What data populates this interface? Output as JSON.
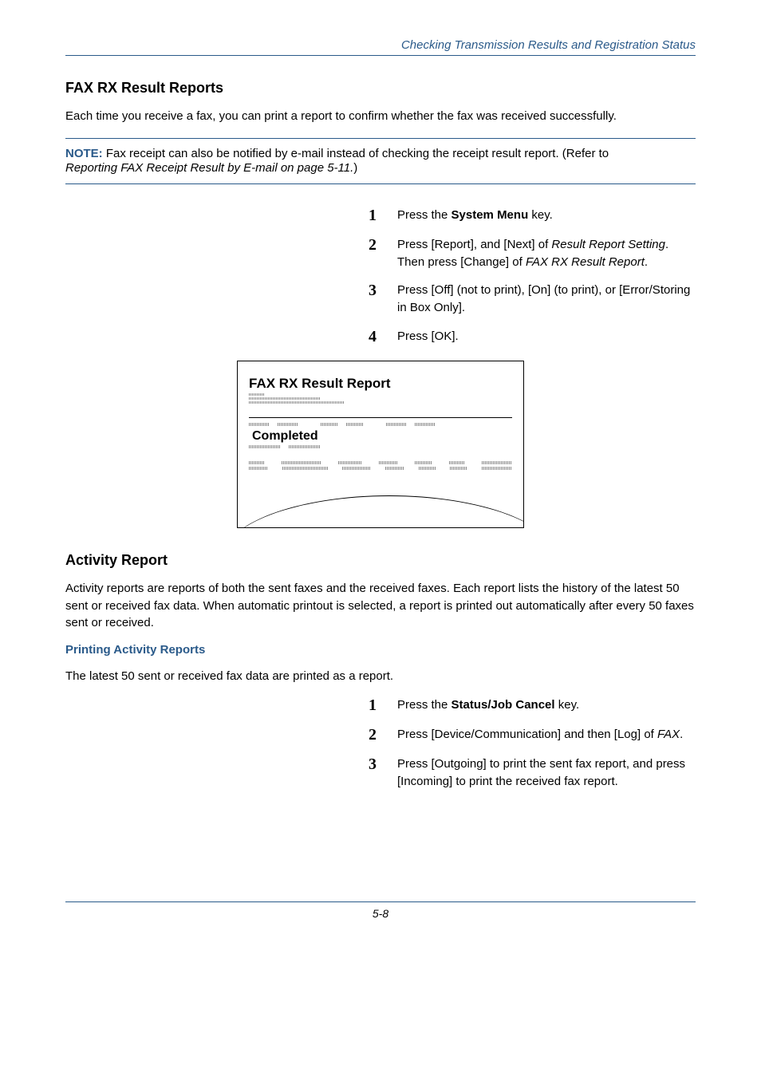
{
  "running_head": "Checking Transmission Results and Registration Status",
  "section1": {
    "title": "FAX RX Result Reports",
    "intro": "Each time you receive a fax, you can print a report to confirm whether the fax was received successfully.",
    "note_label": "NOTE:",
    "note_text": " Fax receipt can also be notified by e-mail instead of checking the receipt result report. (Refer to ",
    "note_ref": "Reporting FAX Receipt Result by E-mail on page 5-11.",
    "note_close": ")",
    "steps": [
      {
        "num": "1",
        "pre": "Press the ",
        "bold": "System Menu",
        "post": " key."
      },
      {
        "num": "2",
        "pre": "Press [Report], and [Next] of ",
        "ital1": "Result Report Setting",
        "mid": ". Then press [Change] of ",
        "ital2": "FAX RX Result Report",
        "post": "."
      },
      {
        "num": "3",
        "pre": "Press [Off] (not to print), [On] (to print), or [Error/Storing in Box Only]."
      },
      {
        "num": "4",
        "pre": "Press [OK]."
      }
    ],
    "report_figure": {
      "title": "FAX RX Result Report",
      "status": "Completed"
    }
  },
  "section2": {
    "title": "Activity Report",
    "intro": "Activity reports are reports of both the sent faxes and the received faxes. Each report lists the history of the latest 50 sent or received fax data. When automatic printout is selected, a report is printed out automatically after every 50 faxes sent or received.",
    "subhead": "Printing Activity Reports",
    "sub_intro": "The latest 50 sent or received fax data are printed as a report.",
    "steps": [
      {
        "num": "1",
        "pre": "Press the ",
        "bold": "Status/Job Cancel",
        "post": " key."
      },
      {
        "num": "2",
        "pre": "Press [Device/Communication] and then [Log] of ",
        "ital1": "FAX",
        "post": "."
      },
      {
        "num": "3",
        "pre": "Press [Outgoing] to print the sent fax report, and press [Incoming] to print the received fax report."
      }
    ]
  },
  "page_number": "5-8"
}
